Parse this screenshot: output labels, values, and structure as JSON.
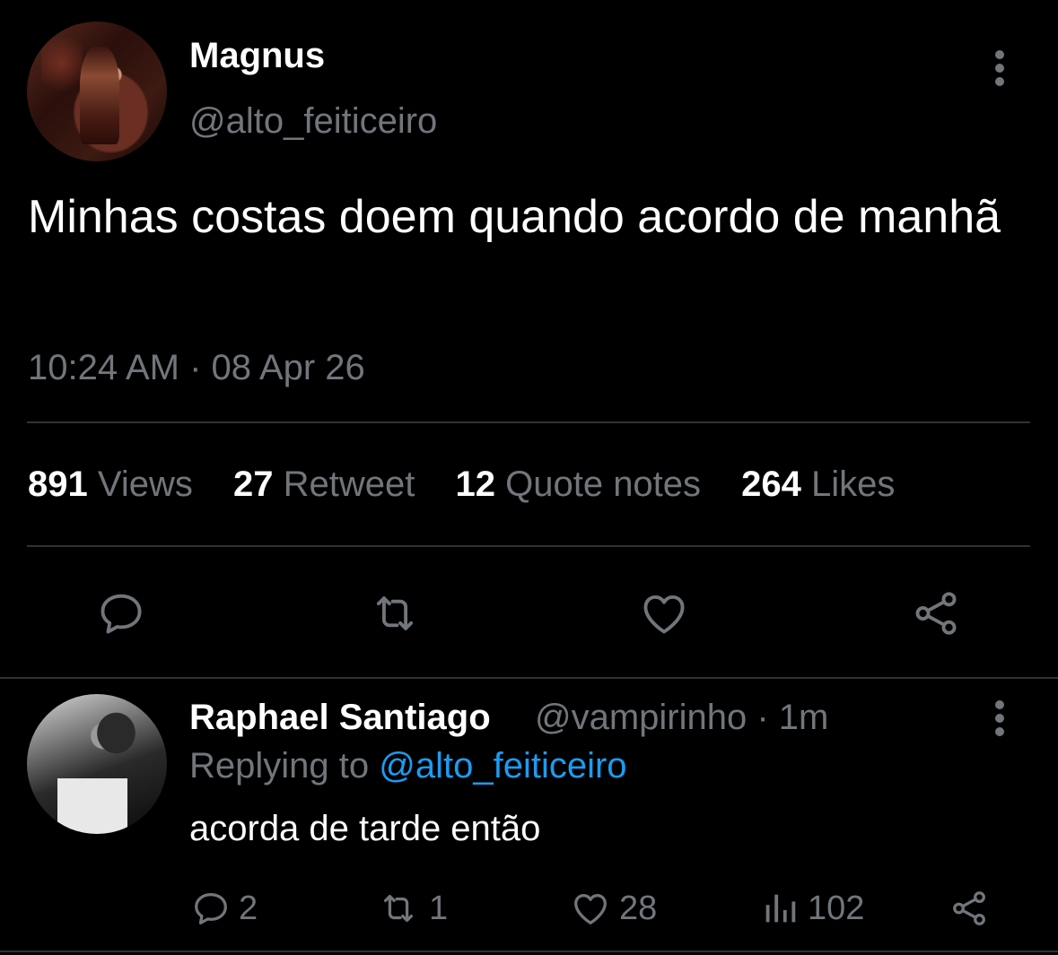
{
  "tweet": {
    "author_name": "Magnus",
    "author_handle": "@alto_feiticeiro",
    "text": "Minhas costas doem quando acordo de manhã",
    "timestamp": "10:24 AM · 08 Apr 26",
    "stats": [
      {
        "count": "891",
        "label": "Views"
      },
      {
        "count": "27",
        "label": "Retweet"
      },
      {
        "count": "12",
        "label": "Quote notes"
      },
      {
        "count": "264",
        "label": "Likes"
      }
    ],
    "actions": [
      "reply-icon",
      "retweet-icon",
      "like-icon",
      "share-icon"
    ]
  },
  "reply": {
    "author_name": "Raphael Santiago",
    "meta": "@vampirinho · 1m",
    "replying_prefix": "Replying to",
    "replying_mention": "@alto_feiticeiro",
    "text": "acorda de tarde então",
    "counts": {
      "replies": "2",
      "retweets": "1",
      "likes": "28",
      "views": "102"
    }
  },
  "colors": {
    "background": "#000000",
    "text": "#e7e9ea",
    "muted": "#71767b",
    "accent": "#1d9bf0",
    "divider": "#2f3336"
  }
}
